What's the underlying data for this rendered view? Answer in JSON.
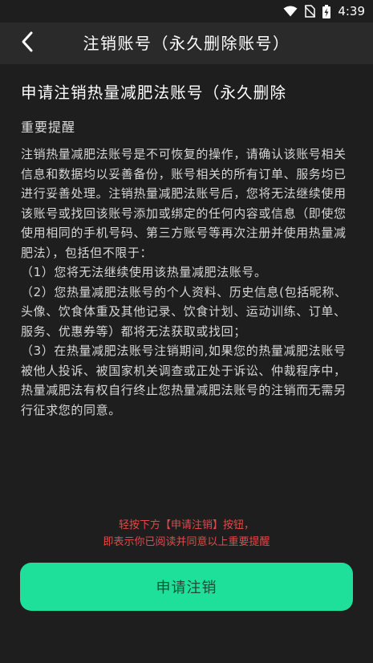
{
  "status_bar": {
    "time": "4:39",
    "icons": [
      "wifi-icon",
      "no-sim-icon",
      "battery-charging-icon"
    ]
  },
  "header": {
    "back_icon": "back-arrow-icon",
    "title": "注销账号（永久删除账号）"
  },
  "content": {
    "heading": "申请注销热量减肥法账号（永久删除",
    "section_label": "重要提醒",
    "paragraphs": [
      "注销热量减肥法账号是不可恢复的操作，请确认该账号相关信息和数据均以妥善备份，账号相关的所有订单、服务均已进行妥善处理。注销热量减肥法账号后，您将无法继续使用该账号或找回该账号添加或绑定的任何内容或信息（即使您使用相同的手机号码、第三方账号等再次注册并使用热量减肥法），包括但不限于：",
      "（1）您将无法继续使用该热量减肥法账号。",
      "（2）您热量减肥法账号的个人资料、历史信息(包括昵称、头像、饮食体重及其他记录、饮食计划、运动训练、订单、服务、优惠券等）都将无法获取或找回；",
      "（3）在热量减肥法账号注销期间,如果您的热量减肥法账号被他人投诉、被国家机关调查或正处于诉讼、仲裁程序中，热量减肥法有权自行终止您热量减肥法账号的注销而无需另行征求您的同意。"
    ]
  },
  "hint": {
    "line1": "轻按下方【申请注销】按钮，",
    "line2": "即表示你已阅读并同意以上重要提醒"
  },
  "apply_button": {
    "label": "申请注销",
    "color": "#1fe09a"
  }
}
